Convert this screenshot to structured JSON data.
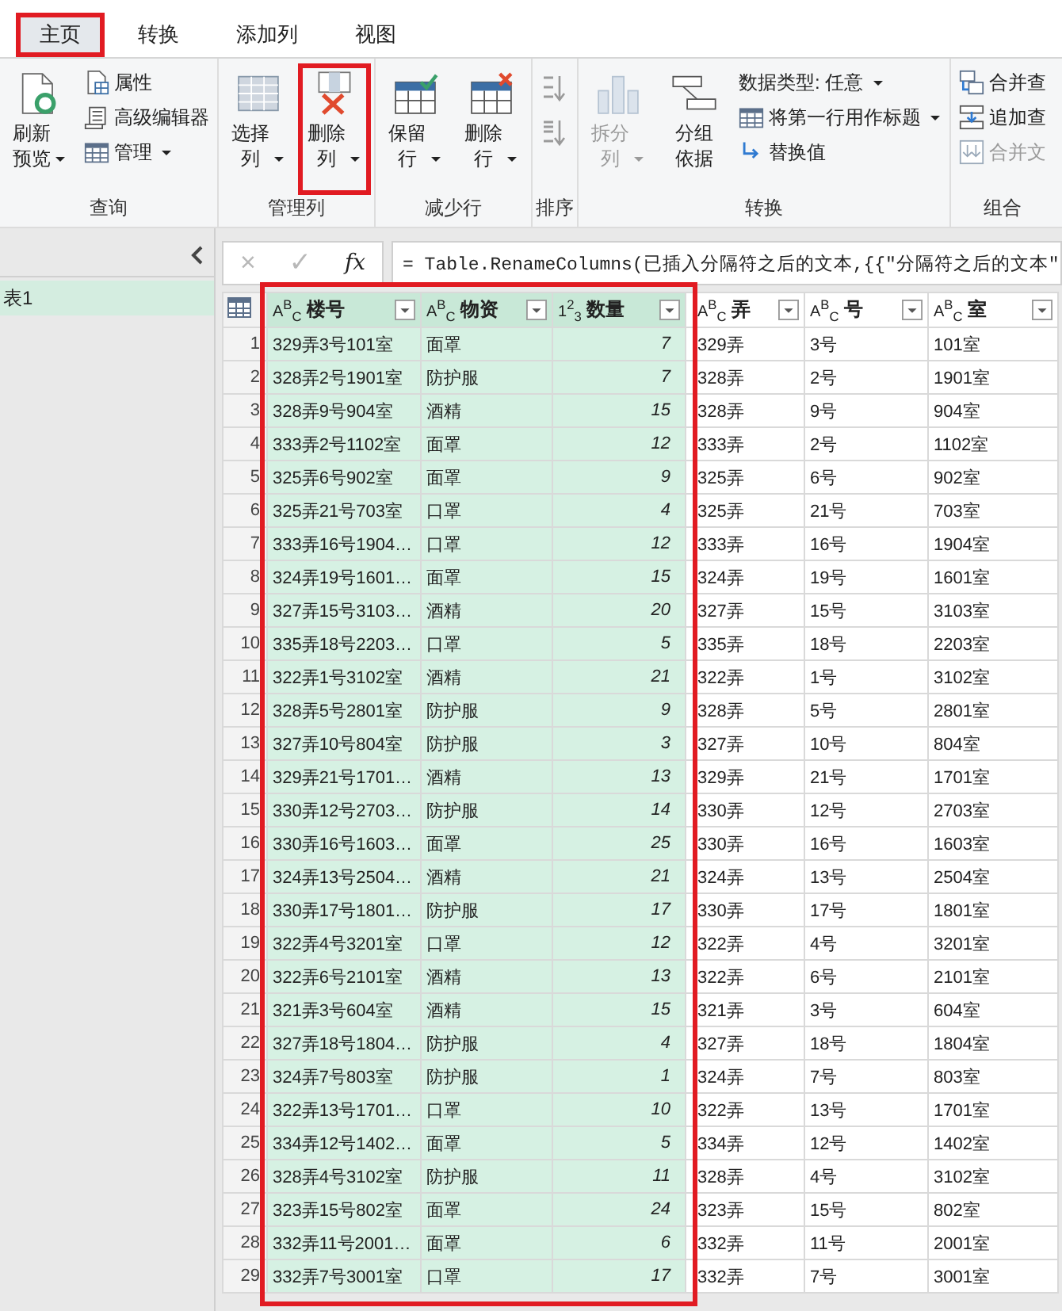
{
  "ribbon": {
    "tabs": [
      {
        "label": "主页",
        "selected": true,
        "highlighted": true
      },
      {
        "label": "转换",
        "selected": false,
        "highlighted": false
      },
      {
        "label": "添加列",
        "selected": false,
        "highlighted": false
      },
      {
        "label": "视图",
        "selected": false,
        "highlighted": false
      }
    ],
    "groups": [
      {
        "label": "查询",
        "items": [
          {
            "kind": "large",
            "label": "刷新预览",
            "dropdown": true,
            "disabled": false,
            "highlighted": false
          },
          {
            "kind": "small",
            "label": "属性",
            "dropdown": false,
            "disabled": false,
            "highlighted": false
          },
          {
            "kind": "small",
            "label": "高级编辑器",
            "dropdown": false,
            "disabled": false,
            "highlighted": false
          },
          {
            "kind": "small",
            "label": "管理",
            "dropdown": true,
            "disabled": false,
            "highlighted": false
          }
        ]
      },
      {
        "label": "管理列",
        "items": [
          {
            "kind": "large",
            "label": "选择列",
            "dropdown": true,
            "disabled": false,
            "highlighted": false
          },
          {
            "kind": "large",
            "label": "删除列",
            "dropdown": true,
            "disabled": false,
            "highlighted": true
          }
        ]
      },
      {
        "label": "减少行",
        "items": [
          {
            "kind": "large",
            "label": "保留行",
            "dropdown": true,
            "disabled": false,
            "highlighted": false
          },
          {
            "kind": "large",
            "label": "删除行",
            "dropdown": true,
            "disabled": false,
            "highlighted": false
          }
        ]
      },
      {
        "label": "排序",
        "items": [
          {
            "kind": "icon",
            "dropdown": false,
            "disabled": true,
            "highlighted": false
          },
          {
            "kind": "icon",
            "dropdown": false,
            "disabled": true,
            "highlighted": false
          }
        ]
      },
      {
        "label": "转换",
        "items": [
          {
            "kind": "large",
            "label": "拆分列",
            "dropdown": true,
            "disabled": true,
            "highlighted": false
          },
          {
            "kind": "large",
            "label": "分组依据",
            "dropdown": false,
            "disabled": false,
            "highlighted": false
          },
          {
            "kind": "small",
            "label": "数据类型: 任意",
            "dropdown": true,
            "disabled": false,
            "highlighted": false
          },
          {
            "kind": "small",
            "label": "将第一行用作标题",
            "dropdown": true,
            "disabled": false,
            "highlighted": false
          },
          {
            "kind": "small",
            "label": "替换值",
            "dropdown": false,
            "disabled": false,
            "highlighted": false
          }
        ]
      },
      {
        "label": "组合",
        "items": [
          {
            "kind": "small",
            "label": "合并查",
            "dropdown": false,
            "disabled": false,
            "highlighted": false
          },
          {
            "kind": "small",
            "label": "追加查",
            "dropdown": false,
            "disabled": false,
            "highlighted": false
          },
          {
            "kind": "small",
            "label": "合并文",
            "dropdown": false,
            "disabled": true,
            "highlighted": false
          }
        ]
      }
    ]
  },
  "queries": {
    "items": [
      {
        "label": "表1",
        "selected": true
      }
    ]
  },
  "formula_bar": {
    "cancel": "×",
    "confirm": "✓",
    "fx": "fx",
    "formula": "= Table.RenameColumns(已插入分隔符之后的文本,{{\"分隔符之后的文本\""
  },
  "table": {
    "columns": [
      {
        "name": "楼号",
        "kind": "text",
        "type_icon": "A$^{B}$$_{C}$",
        "selected": true
      },
      {
        "name": "物资",
        "kind": "text",
        "type_icon": "A$^{B}$$_{C}$",
        "selected": true
      },
      {
        "name": "数量",
        "kind": "number",
        "type_icon": "1$^{2}$$_{3}$",
        "selected": true
      },
      {
        "name": "弄",
        "kind": "text",
        "type_icon": "A$^{B}$$_{C}$",
        "selected": false
      },
      {
        "name": "号",
        "kind": "text",
        "type_icon": "A$^{B}$$_{C}$",
        "selected": false
      },
      {
        "name": "室",
        "kind": "text",
        "type_icon": "A$^{B}$$_{C}$",
        "selected": false
      }
    ],
    "rows": [
      {
        "number": "1",
        "cells": [
          "329弄3号101室",
          "面罩",
          "7",
          "329弄",
          "3号",
          "101室"
        ]
      },
      {
        "number": "2",
        "cells": [
          "328弄2号1901室",
          "防护服",
          "7",
          "328弄",
          "2号",
          "1901室"
        ]
      },
      {
        "number": "3",
        "cells": [
          "328弄9号904室",
          "酒精",
          "15",
          "328弄",
          "9号",
          "904室"
        ]
      },
      {
        "number": "4",
        "cells": [
          "333弄2号1102室",
          "面罩",
          "12",
          "333弄",
          "2号",
          "1102室"
        ]
      },
      {
        "number": "5",
        "cells": [
          "325弄6号902室",
          "面罩",
          "9",
          "325弄",
          "6号",
          "902室"
        ]
      },
      {
        "number": "6",
        "cells": [
          "325弄21号703室",
          "口罩",
          "4",
          "325弄",
          "21号",
          "703室"
        ]
      },
      {
        "number": "7",
        "cells": [
          "333弄16号1904…",
          "口罩",
          "12",
          "333弄",
          "16号",
          "1904室"
        ]
      },
      {
        "number": "8",
        "cells": [
          "324弄19号1601…",
          "面罩",
          "15",
          "324弄",
          "19号",
          "1601室"
        ]
      },
      {
        "number": "9",
        "cells": [
          "327弄15号3103…",
          "酒精",
          "20",
          "327弄",
          "15号",
          "3103室"
        ]
      },
      {
        "number": "10",
        "cells": [
          "335弄18号2203…",
          "口罩",
          "5",
          "335弄",
          "18号",
          "2203室"
        ]
      },
      {
        "number": "11",
        "cells": [
          "322弄1号3102室",
          "酒精",
          "21",
          "322弄",
          "1号",
          "3102室"
        ]
      },
      {
        "number": "12",
        "cells": [
          "328弄5号2801室",
          "防护服",
          "9",
          "328弄",
          "5号",
          "2801室"
        ]
      },
      {
        "number": "13",
        "cells": [
          "327弄10号804室",
          "防护服",
          "3",
          "327弄",
          "10号",
          "804室"
        ]
      },
      {
        "number": "14",
        "cells": [
          "329弄21号1701…",
          "酒精",
          "13",
          "329弄",
          "21号",
          "1701室"
        ]
      },
      {
        "number": "15",
        "cells": [
          "330弄12号2703…",
          "防护服",
          "14",
          "330弄",
          "12号",
          "2703室"
        ]
      },
      {
        "number": "16",
        "cells": [
          "330弄16号1603…",
          "面罩",
          "25",
          "330弄",
          "16号",
          "1603室"
        ]
      },
      {
        "number": "17",
        "cells": [
          "324弄13号2504…",
          "酒精",
          "21",
          "324弄",
          "13号",
          "2504室"
        ]
      },
      {
        "number": "18",
        "cells": [
          "330弄17号1801…",
          "防护服",
          "17",
          "330弄",
          "17号",
          "1801室"
        ]
      },
      {
        "number": "19",
        "cells": [
          "322弄4号3201室",
          "口罩",
          "12",
          "322弄",
          "4号",
          "3201室"
        ]
      },
      {
        "number": "20",
        "cells": [
          "322弄6号2101室",
          "酒精",
          "13",
          "322弄",
          "6号",
          "2101室"
        ]
      },
      {
        "number": "21",
        "cells": [
          "321弄3号604室",
          "酒精",
          "15",
          "321弄",
          "3号",
          "604室"
        ]
      },
      {
        "number": "22",
        "cells": [
          "327弄18号1804…",
          "防护服",
          "4",
          "327弄",
          "18号",
          "1804室"
        ]
      },
      {
        "number": "23",
        "cells": [
          "324弄7号803室",
          "防护服",
          "1",
          "324弄",
          "7号",
          "803室"
        ]
      },
      {
        "number": "24",
        "cells": [
          "322弄13号1701…",
          "口罩",
          "10",
          "322弄",
          "13号",
          "1701室"
        ]
      },
      {
        "number": "25",
        "cells": [
          "334弄12号1402…",
          "面罩",
          "5",
          "334弄",
          "12号",
          "1402室"
        ]
      },
      {
        "number": "26",
        "cells": [
          "328弄4号3102室",
          "防护服",
          "11",
          "328弄",
          "4号",
          "3102室"
        ]
      },
      {
        "number": "27",
        "cells": [
          "323弄15号802室",
          "面罩",
          "24",
          "323弄",
          "15号",
          "802室"
        ]
      },
      {
        "number": "28",
        "cells": [
          "332弄11号2001…",
          "面罩",
          "6",
          "332弄",
          "11号",
          "2001室"
        ]
      },
      {
        "number": "29",
        "cells": [
          "332弄7号3001室",
          "口罩",
          "17",
          "332弄",
          "7号",
          "3001室"
        ]
      }
    ]
  }
}
